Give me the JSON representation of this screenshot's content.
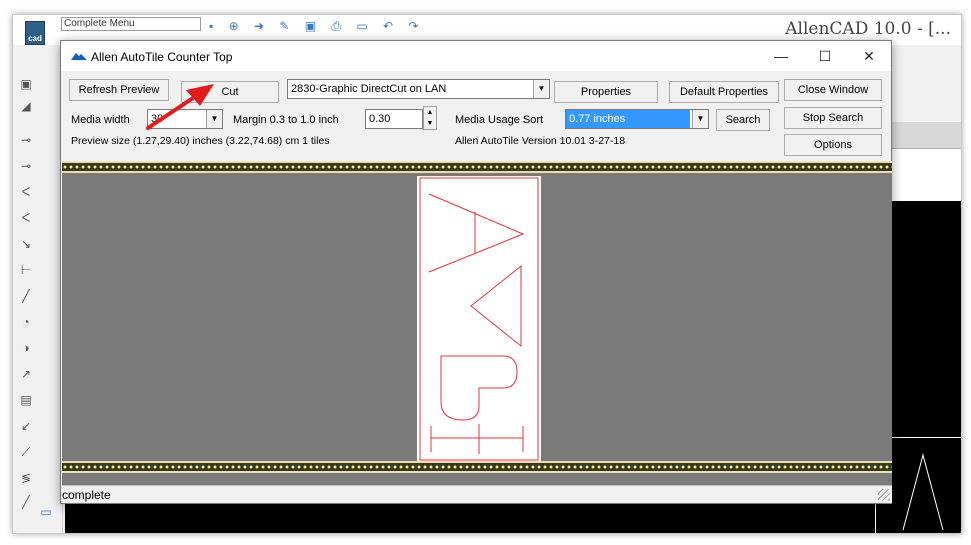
{
  "background_app": {
    "menu_combo": "Complete Menu",
    "title": "AllenCAD 10.0 - [..."
  },
  "dialog": {
    "title": "Allen AutoTile Counter Top",
    "window_controls": {
      "minimize": "—",
      "maximize": "☐",
      "close": "✕"
    },
    "buttons": {
      "refresh_preview": "Refresh Preview",
      "cut": "Cut",
      "properties": "Properties",
      "default_properties": "Default Properties",
      "close_window": "Close Window",
      "stop_search": "Stop Search",
      "search": "Search",
      "options": "Options"
    },
    "device_combo": {
      "value": "2830-Graphic DirectCut on LAN"
    },
    "media_width": {
      "label": "Media width",
      "value": "30"
    },
    "margin": {
      "label": "Margin 0.3 to 1.0 inch",
      "value": "0.30"
    },
    "media_usage_sort": {
      "label": "Media Usage Sort",
      "value": "0.77 inches"
    },
    "preview_size": "Preview size (1.27,29.40) inches  (3.22,74.68) cm   1 tiles",
    "version": "Allen AutoTile Version 10.01 3-27-18",
    "status": "complete"
  },
  "colors": {
    "selection_blue": "#3399ff",
    "cut_line_red": "#e8303a",
    "annotation_arrow": "#e31b1b",
    "preview_gray": "#7a7a7a"
  },
  "icons": [
    "app-logo-icon",
    "autotile-icon",
    "dropdown-arrow-icon",
    "spin-up-icon",
    "spin-down-icon",
    "resize-grip-icon"
  ]
}
